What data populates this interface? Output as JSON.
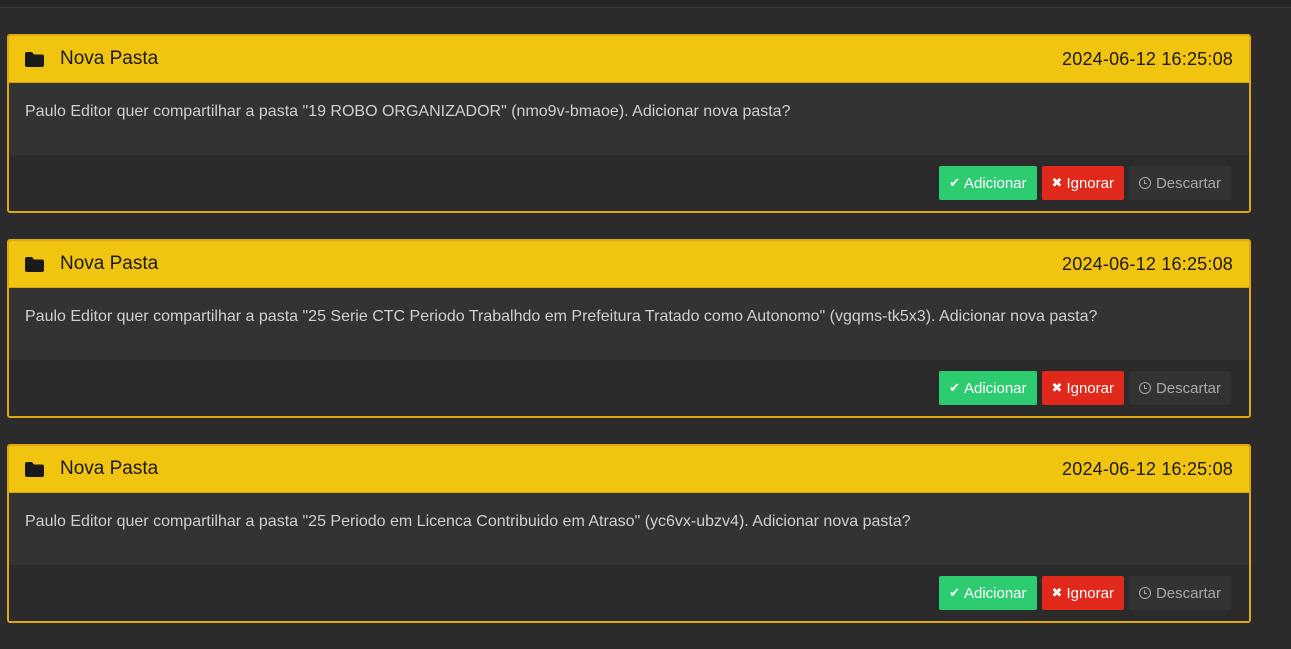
{
  "notifications": [
    {
      "title": "Nova Pasta",
      "date": "2024-06-12 16:25:08",
      "message": "Paulo Editor quer compartilhar a pasta \"19 ROBO ORGANIZADOR\" (nmo9v-bmaoe). Adicionar nova pasta?",
      "add_label": "Adicionar",
      "ignore_label": "Ignorar",
      "discard_label": "Descartar"
    },
    {
      "title": "Nova Pasta",
      "date": "2024-06-12 16:25:08",
      "message": "Paulo Editor quer compartilhar a pasta \"25 Serie CTC Periodo Trabalhdo em Prefeitura Tratado como Autonomo\" (vgqms-tk5x3). Adicionar nova pasta?",
      "add_label": "Adicionar",
      "ignore_label": "Ignorar",
      "discard_label": "Descartar"
    },
    {
      "title": "Nova Pasta",
      "date": "2024-06-12 16:25:08",
      "message": "Paulo Editor quer compartilhar a pasta \"25 Periodo em Licenca Contribuido em Atraso\" (yc6vx-ubzv4). Adicionar nova pasta?",
      "add_label": "Adicionar",
      "ignore_label": "Ignorar",
      "discard_label": "Descartar"
    }
  ],
  "icons": {
    "header": "folder-icon",
    "add": "check-icon",
    "ignore": "times-icon",
    "discard": "clock-icon"
  },
  "colors": {
    "header_bg": "#f1c40f",
    "card_border": "#e0a713",
    "add_button": "#2ecc71",
    "ignore_button": "#e0291b",
    "page_bg": "#2b2b2b"
  }
}
